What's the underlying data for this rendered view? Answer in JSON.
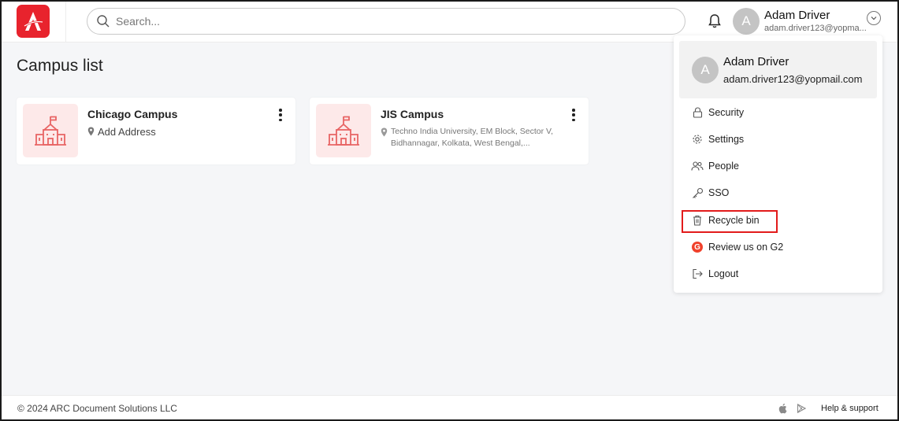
{
  "header": {
    "search_placeholder": "Search...",
    "user_initial": "A",
    "user_name": "Adam Driver",
    "user_email_truncated": "adam.driver123@yopma..."
  },
  "main": {
    "title": "Campus list",
    "campuses": [
      {
        "name": "Chicago Campus",
        "address": "Add Address"
      },
      {
        "name": "JIS Campus",
        "address": "Techno India University, EM Block, Sector V, Bidhannagar, Kolkata, West Bengal,..."
      }
    ]
  },
  "dropdown": {
    "user_initial": "A",
    "user_name": "Adam Driver",
    "user_email": "adam.driver123@yopmail.com",
    "items": [
      {
        "label": "Security",
        "icon": "lock-icon"
      },
      {
        "label": "Settings",
        "icon": "gear-icon"
      },
      {
        "label": "People",
        "icon": "people-icon"
      },
      {
        "label": "SSO",
        "icon": "key-icon"
      },
      {
        "label": "Recycle bin",
        "icon": "trash-icon"
      },
      {
        "label": "Review us on G2",
        "icon": "g2-icon",
        "icon_text": "G"
      },
      {
        "label": "Logout",
        "icon": "logout-icon"
      }
    ]
  },
  "footer": {
    "copyright": "© 2024 ARC Document Solutions LLC",
    "help": "Help & support"
  },
  "colors": {
    "brand": "#e8232d",
    "highlight": "#e21b1b",
    "card_thumb_bg": "#fde9e9",
    "icon_red": "#e86464"
  }
}
